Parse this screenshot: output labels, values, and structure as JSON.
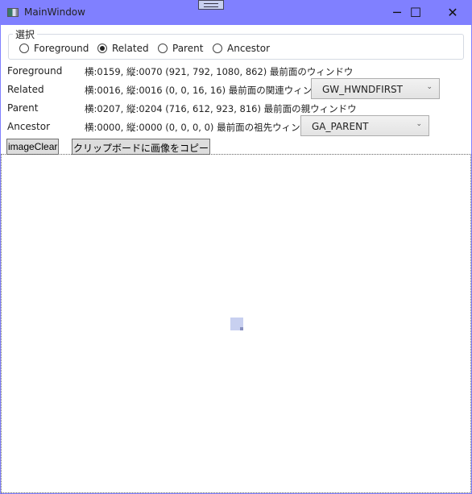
{
  "window": {
    "title": "MainWindow",
    "minimize": "─",
    "maximize": "☐",
    "close": "✕"
  },
  "group": {
    "label": "選択",
    "options": [
      {
        "label": "Foreground",
        "checked": false
      },
      {
        "label": "Related",
        "checked": true
      },
      {
        "label": "Parent",
        "checked": false
      },
      {
        "label": "Ancestor",
        "checked": false
      }
    ]
  },
  "rows": [
    {
      "label": "Foreground",
      "info": "横:0159, 縦:0070  (921, 792, 1080, 862) 最前面のウィンドウ"
    },
    {
      "label": "Related",
      "info": "横:0016, 縦:0016  (0, 0, 16, 16) 最前面の関連ウィンドウ",
      "combo": "GW_HWNDFIRST"
    },
    {
      "label": "Parent",
      "info": "横:0207, 縦:0204  (716, 612, 923, 816) 最前面の親ウィンドウ"
    },
    {
      "label": "Ancestor",
      "info": "横:0000, 縦:0000  (0, 0, 0, 0) 最前面の祖先ウィンドウ",
      "combo": "GA_PARENT"
    }
  ],
  "buttons": {
    "clear": "imageClear",
    "copy": "クリップボードに画像をコピー"
  },
  "colors": {
    "titlebar": "#8080ff"
  }
}
